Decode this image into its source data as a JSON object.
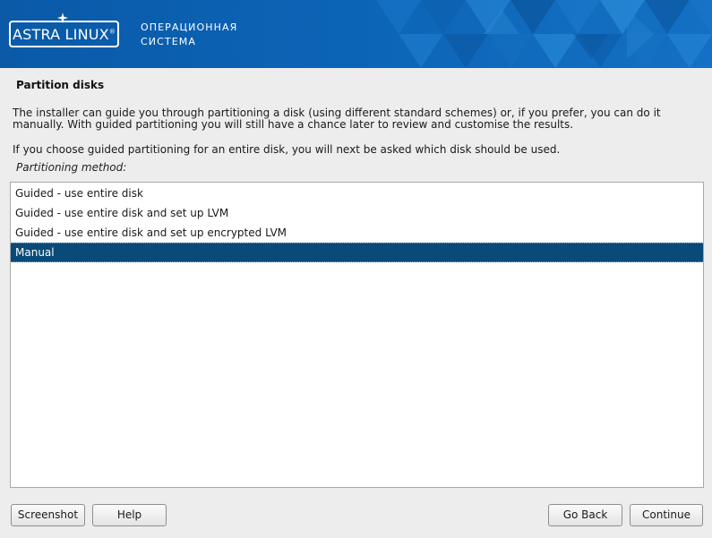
{
  "header": {
    "logo_text": "ASTRA LINUX",
    "logo_mark": "®",
    "os_label_line1": "ОПЕРАЦИОННАЯ",
    "os_label_line2": "СИСТЕМА"
  },
  "page": {
    "title": "Partition disks",
    "paragraph_1": "The installer can guide you through partitioning a disk (using different standard schemes) or, if you prefer, you can do it manually. With guided partitioning you will still have a chance later to review and customise the results.",
    "paragraph_2": "If you choose guided partitioning for an entire disk, you will next be asked which disk should be used.",
    "method_label": "Partitioning method:"
  },
  "methods": {
    "items": [
      {
        "label": "Guided - use entire disk"
      },
      {
        "label": "Guided - use entire disk and set up LVM"
      },
      {
        "label": "Guided - use entire disk and set up encrypted LVM"
      },
      {
        "label": "Manual"
      }
    ],
    "selected_label": "Manual"
  },
  "buttons": {
    "screenshot": "Screenshot",
    "help": "Help",
    "go_back": "Go Back",
    "continue": "Continue"
  },
  "colors": {
    "banner_blue": "#0c63b5",
    "selection": "#0a4a78",
    "background": "#ededed"
  }
}
